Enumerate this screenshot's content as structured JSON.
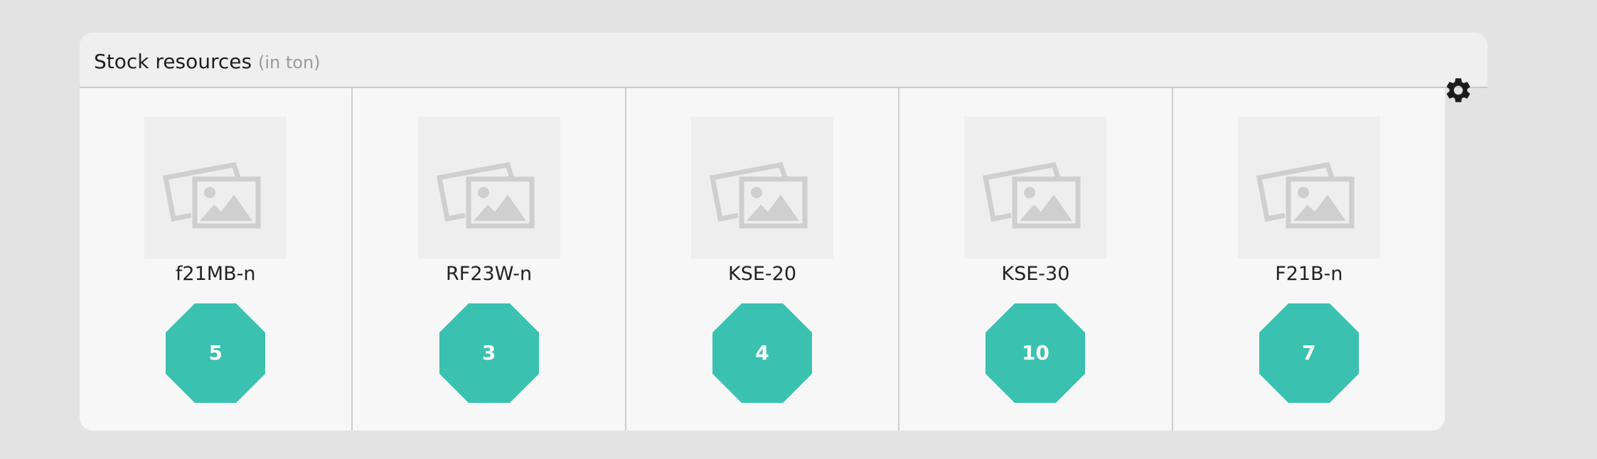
{
  "widget": {
    "title": "Stock resources",
    "subtitle": "(in ton)",
    "settings_icon": "gear-icon"
  },
  "colors": {
    "badge": "#3bc1b0",
    "image_placeholder": "#cfcfcf"
  },
  "items": [
    {
      "name": "f21MB-n",
      "value": "5",
      "image_icon": "image-placeholder-icon"
    },
    {
      "name": "RF23W-n",
      "value": "3",
      "image_icon": "image-placeholder-icon"
    },
    {
      "name": "KSE-20",
      "value": "4",
      "image_icon": "image-placeholder-icon"
    },
    {
      "name": "KSE-30",
      "value": "10",
      "image_icon": "image-placeholder-icon"
    },
    {
      "name": "F21B-n",
      "value": "7",
      "image_icon": "image-placeholder-icon"
    }
  ]
}
